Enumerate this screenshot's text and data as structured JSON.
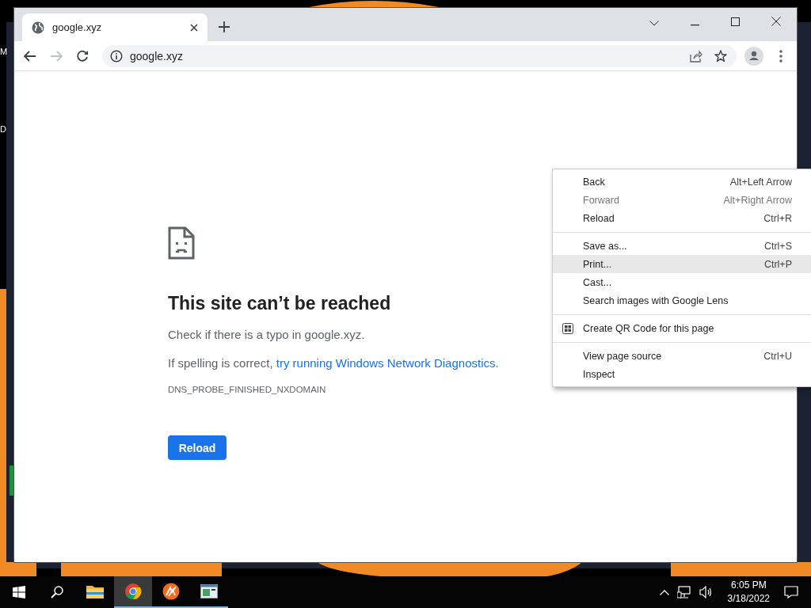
{
  "desktop": {
    "edge_letters": [
      "M",
      "D"
    ]
  },
  "browser": {
    "tabs": [
      {
        "title": "google.xyz",
        "selected": true
      }
    ],
    "address": "google.xyz",
    "nav": {
      "back_disabled": false,
      "forward_disabled": true
    },
    "error": {
      "title": "This site can’t be reached",
      "hint": "Check if there is a typo in google.xyz.",
      "suggestion": "If spelling is correct, ",
      "suggestion_link": "try running Windows Network Diagnostics.",
      "code": "DNS_PROBE_FINISHED_NXDOMAIN",
      "button": "Reload"
    }
  },
  "context_menu": {
    "groups": [
      [
        {
          "label": "Back",
          "shortcut": "Alt+Left Arrow",
          "kind": "plain",
          "disabled": false,
          "selected": false
        },
        {
          "label": "Forward",
          "shortcut": "Alt+Right Arrow",
          "kind": "plain",
          "disabled": true,
          "selected": false
        },
        {
          "label": "Reload",
          "shortcut": "Ctrl+R",
          "kind": "plain",
          "disabled": false,
          "selected": false
        }
      ],
      [
        {
          "label": "Save as...",
          "shortcut": "Ctrl+S",
          "kind": "plain",
          "disabled": false,
          "selected": false
        },
        {
          "label": "Print...",
          "shortcut": "Ctrl+P",
          "kind": "plain",
          "disabled": false,
          "selected": true
        },
        {
          "label": "Cast...",
          "kind": "plain",
          "disabled": false,
          "selected": false
        },
        {
          "label": "Search images with Google Lens",
          "kind": "plain",
          "disabled": false,
          "selected": false
        }
      ],
      [
        {
          "label": "Create QR Code for this page",
          "kind": "qr",
          "disabled": false,
          "selected": false
        }
      ],
      [
        {
          "label": "View page source",
          "shortcut": "Ctrl+U",
          "kind": "plain",
          "disabled": false,
          "selected": false
        },
        {
          "label": "Inspect",
          "kind": "plain",
          "disabled": false,
          "selected": false
        }
      ]
    ]
  },
  "taskbar": {
    "apps": [
      {
        "kind": "explorer",
        "running": false,
        "selected": false
      },
      {
        "kind": "chrome",
        "running": true,
        "selected": true
      },
      {
        "kind": "orange",
        "running": true,
        "selected": false
      },
      {
        "kind": "window",
        "running": true,
        "selected": false
      }
    ],
    "time": "6:05 PM",
    "date": "3/18/2022"
  }
}
